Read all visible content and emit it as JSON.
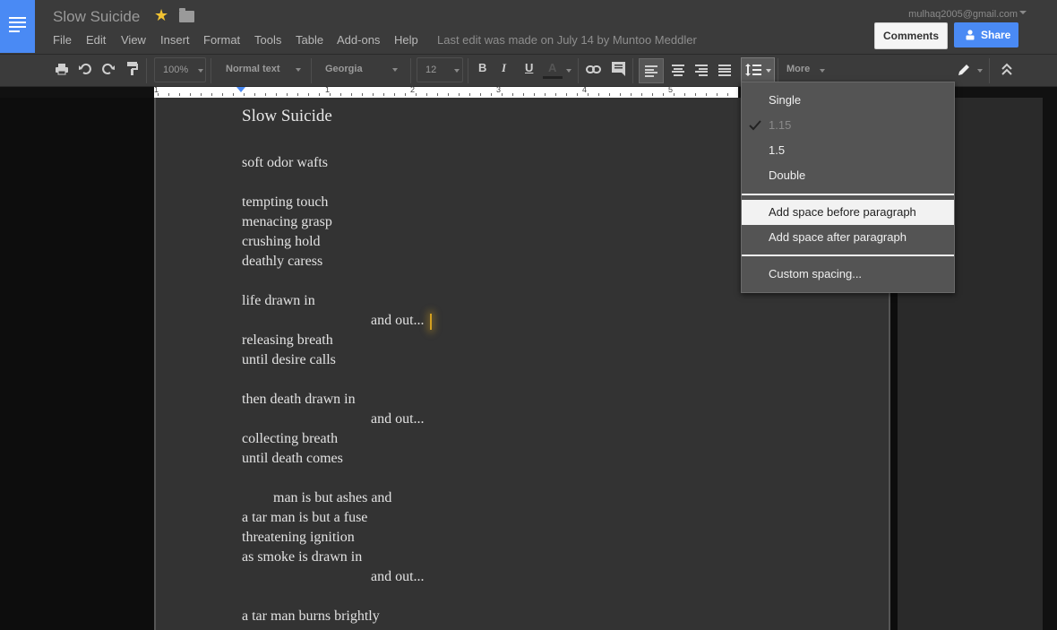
{
  "header": {
    "doc_title": "Slow Suicide",
    "last_edit": "Last edit was made on July 14 by Muntoo Meddler",
    "account_email": "mulhaq2005@gmail.com",
    "comments_label": "Comments",
    "share_label": "Share"
  },
  "menubar": [
    "File",
    "Edit",
    "View",
    "Insert",
    "Format",
    "Tools",
    "Table",
    "Add-ons",
    "Help"
  ],
  "toolbar": {
    "zoom": "100%",
    "style": "Normal text",
    "font": "Georgia",
    "size": "12",
    "bold": "B",
    "italic": "I",
    "underline": "U",
    "text_color": "A",
    "more": "More",
    "icons": [
      "print-icon",
      "undo-icon",
      "redo-icon",
      "paint-format-icon",
      "link-icon",
      "comment-icon",
      "align-left-icon",
      "align-center-icon",
      "align-right-icon",
      "justify-icon",
      "line-spacing-icon",
      "pencil-icon",
      "collapse-icon"
    ]
  },
  "ruler": {
    "numbers": [
      "1",
      "1",
      "2",
      "3",
      "4",
      "5"
    ]
  },
  "document": {
    "heading": "Slow Suicide",
    "lines": [
      "soft odor wafts",
      "tempting touch",
      "menacing grasp",
      "crushing hold",
      "deathly caress",
      "life drawn in",
      "and out...",
      "releasing breath",
      "until desire calls",
      "then death drawn in",
      "and out...",
      "collecting breath",
      "until death comes",
      "man is but ashes and",
      "a tar man is but a fuse",
      "threatening ignition",
      "as smoke is drawn in",
      "and out...",
      "a tar man burns brightly"
    ]
  },
  "spacing_menu": {
    "items": [
      "Single",
      "1.15",
      "1.5",
      "Double"
    ],
    "selected": "1.15",
    "paragraph_items": [
      "Add space before paragraph",
      "Add space after paragraph"
    ],
    "custom": "Custom spacing..."
  },
  "colors": {
    "accent": "#4a8af4",
    "star": "#f1c232",
    "cursor": "#d4a020"
  }
}
